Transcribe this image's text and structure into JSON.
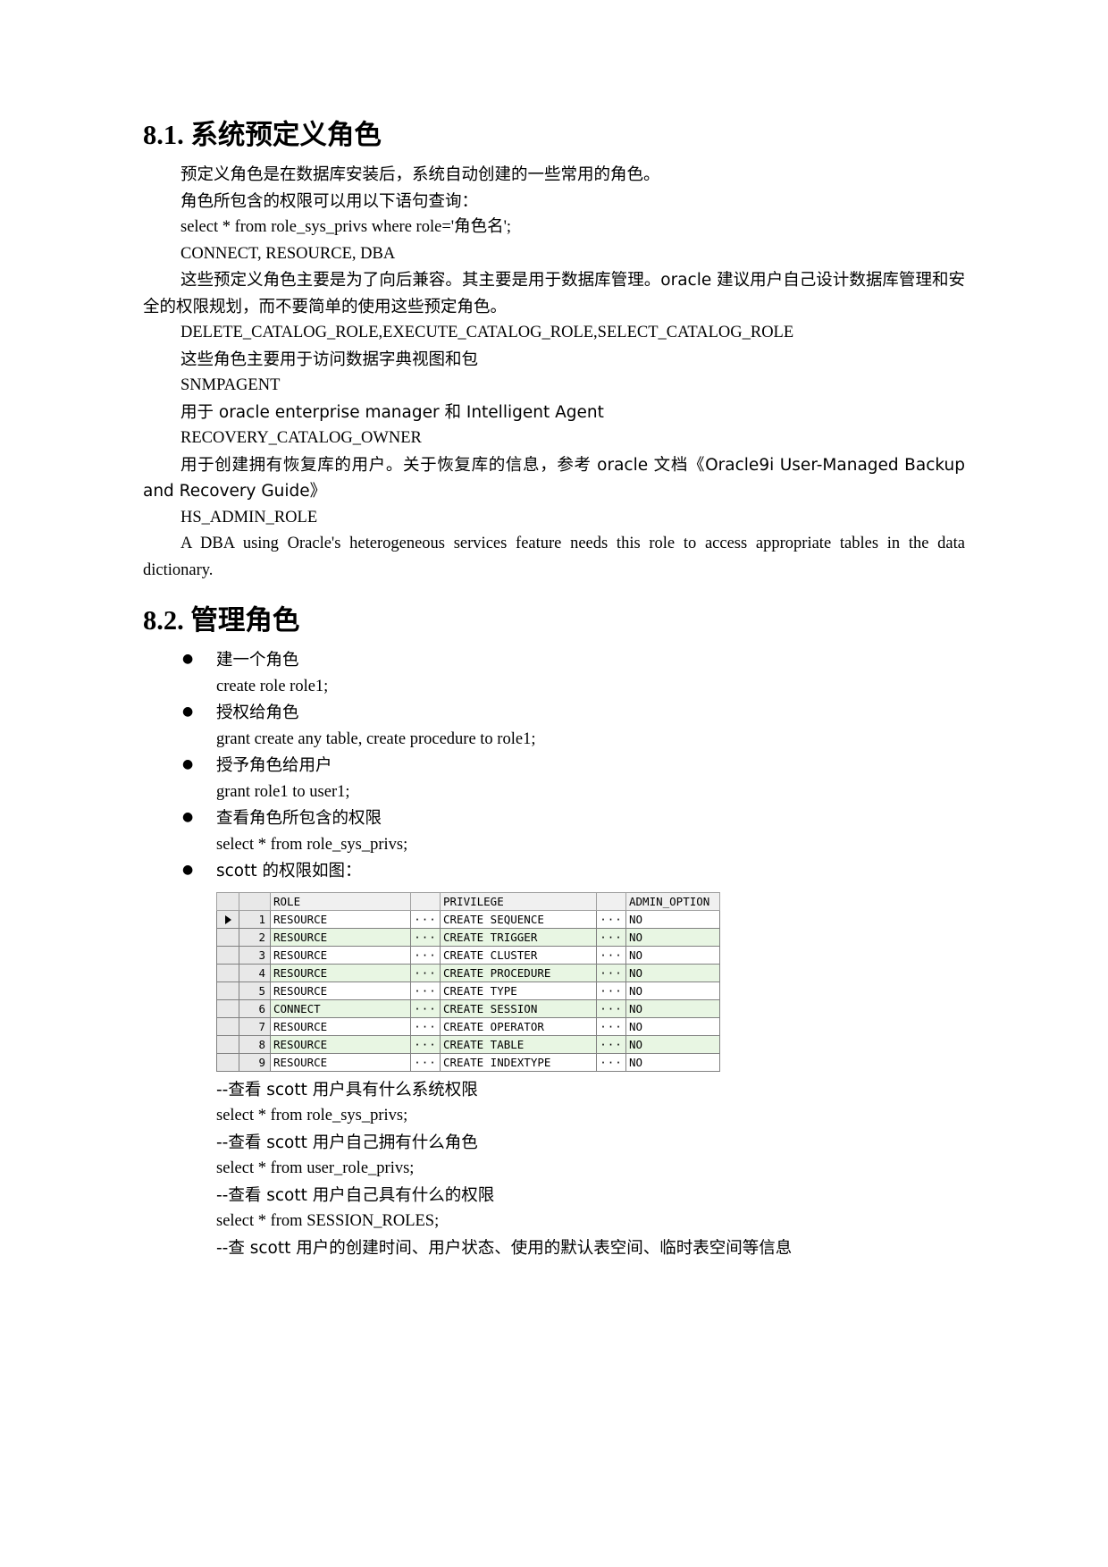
{
  "sections": {
    "s1": {
      "number": "8.1.",
      "title": "系统预定义角色",
      "paras": [
        "预定义角色是在数据库安装后，系统自动创建的一些常用的角色。",
        "角色所包含的权限可以用以下语句查询：",
        "select * from role_sys_privs where role='角色名';",
        "CONNECT, RESOURCE, DBA",
        "这些预定义角色主要是为了向后兼容。其主要是用于数据库管理。oracle 建议用户自己设计数据库管理和安全的权限规划，而不要简单的使用这些预定角色。",
        "DELETE_CATALOG_ROLE,EXECUTE_CATALOG_ROLE,SELECT_CATALOG_ROLE",
        "这些角色主要用于访问数据字典视图和包",
        "SNMPAGENT",
        "用于 oracle enterprise manager 和 Intelligent Agent",
        "RECOVERY_CATALOG_OWNER",
        "用于创建拥有恢复库的用户。关于恢复库的信息，参考 oracle 文档《Oracle9i User-Managed Backup and Recovery Guide》",
        "HS_ADMIN_ROLE",
        "A DBA using Oracle's heterogeneous services feature needs this role to access appropriate tables in the data dictionary."
      ]
    },
    "s2": {
      "number": "8.2.",
      "title": "管理角色",
      "bullets": [
        {
          "label": "建一个角色",
          "code": "create role role1;"
        },
        {
          "label": "授权给角色",
          "code": "grant create any table, create procedure to role1;"
        },
        {
          "label": "授予角色给用户",
          "code": "grant role1 to user1;"
        },
        {
          "label": "查看角色所包含的权限",
          "code": "select * from role_sys_privs;"
        },
        {
          "label": "scott 的权限如图：",
          "code": ""
        }
      ],
      "trailing_lines": [
        "--查看 scott 用户具有什么系统权限",
        "select * from role_sys_privs;",
        "--查看 scott 用户自己拥有什么角色",
        "select * from user_role_privs;",
        "--查看 scott 用户自己具有什么的权限",
        "select * from SESSION_ROLES;",
        "--查 scott 用户的创建时间、用户状态、使用的默认表空间、临时表空间等信息"
      ]
    }
  },
  "grid": {
    "headers": [
      "",
      "",
      "ROLE",
      "",
      "PRIVILEGE",
      "",
      "ADMIN_OPTION"
    ],
    "dots": "···",
    "rows": [
      {
        "n": "1",
        "role": "RESOURCE",
        "privilege": "CREATE SEQUENCE",
        "admin": "NO",
        "selected": true,
        "alt": false
      },
      {
        "n": "2",
        "role": "RESOURCE",
        "privilege": "CREATE TRIGGER",
        "admin": "NO",
        "selected": false,
        "alt": true
      },
      {
        "n": "3",
        "role": "RESOURCE",
        "privilege": "CREATE CLUSTER",
        "admin": "NO",
        "selected": false,
        "alt": false
      },
      {
        "n": "4",
        "role": "RESOURCE",
        "privilege": "CREATE PROCEDURE",
        "admin": "NO",
        "selected": false,
        "alt": true
      },
      {
        "n": "5",
        "role": "RESOURCE",
        "privilege": "CREATE TYPE",
        "admin": "NO",
        "selected": false,
        "alt": false
      },
      {
        "n": "6",
        "role": "CONNECT",
        "privilege": "CREATE SESSION",
        "admin": "NO",
        "selected": false,
        "alt": true
      },
      {
        "n": "7",
        "role": "RESOURCE",
        "privilege": "CREATE OPERATOR",
        "admin": "NO",
        "selected": false,
        "alt": false
      },
      {
        "n": "8",
        "role": "RESOURCE",
        "privilege": "CREATE TABLE",
        "admin": "NO",
        "selected": false,
        "alt": true
      },
      {
        "n": "9",
        "role": "RESOURCE",
        "privilege": "CREATE INDEXTYPE",
        "admin": "NO",
        "selected": false,
        "alt": false
      }
    ]
  }
}
